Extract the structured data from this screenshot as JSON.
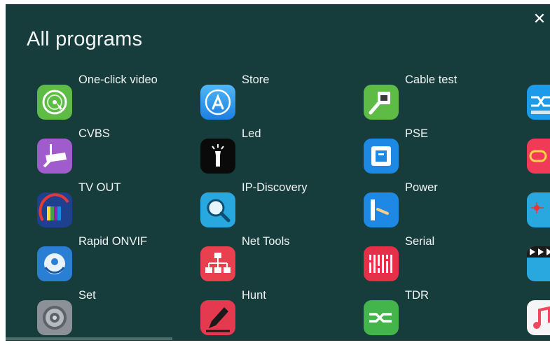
{
  "header": {
    "title": "All programs",
    "close_glyph": "✕"
  },
  "colors": {
    "background": "#173c3c",
    "text": "#f0f4f4"
  },
  "apps": [
    {
      "label": "One-click video",
      "icon": "one-click-video-icon"
    },
    {
      "label": "Store",
      "icon": "store-icon"
    },
    {
      "label": "Cable test",
      "icon": "cable-test-icon"
    },
    {
      "label": "CVBS",
      "icon": "cvbs-camera-icon"
    },
    {
      "label": "Led",
      "icon": "led-flashlight-icon"
    },
    {
      "label": "PSE",
      "icon": "pse-port-icon"
    },
    {
      "label": "TV OUT",
      "icon": "tv-out-icon"
    },
    {
      "label": "IP-Discovery",
      "icon": "ip-discovery-icon"
    },
    {
      "label": "Power",
      "icon": "power-icon"
    },
    {
      "label": "Rapid ONVIF",
      "icon": "rapid-onvif-icon"
    },
    {
      "label": "Net Tools",
      "icon": "net-tools-icon"
    },
    {
      "label": "Serial",
      "icon": "serial-icon"
    },
    {
      "label": "Set",
      "icon": "settings-gear-icon"
    },
    {
      "label": "Hunt",
      "icon": "hunt-pen-icon"
    },
    {
      "label": "TDR",
      "icon": "tdr-icon"
    }
  ],
  "partial_apps": [
    {
      "icon": "cable-tracer-icon"
    },
    {
      "icon": "optical-power-icon"
    },
    {
      "icon": "laser-icon"
    },
    {
      "icon": "video-player-icon"
    },
    {
      "icon": "music-icon"
    }
  ]
}
